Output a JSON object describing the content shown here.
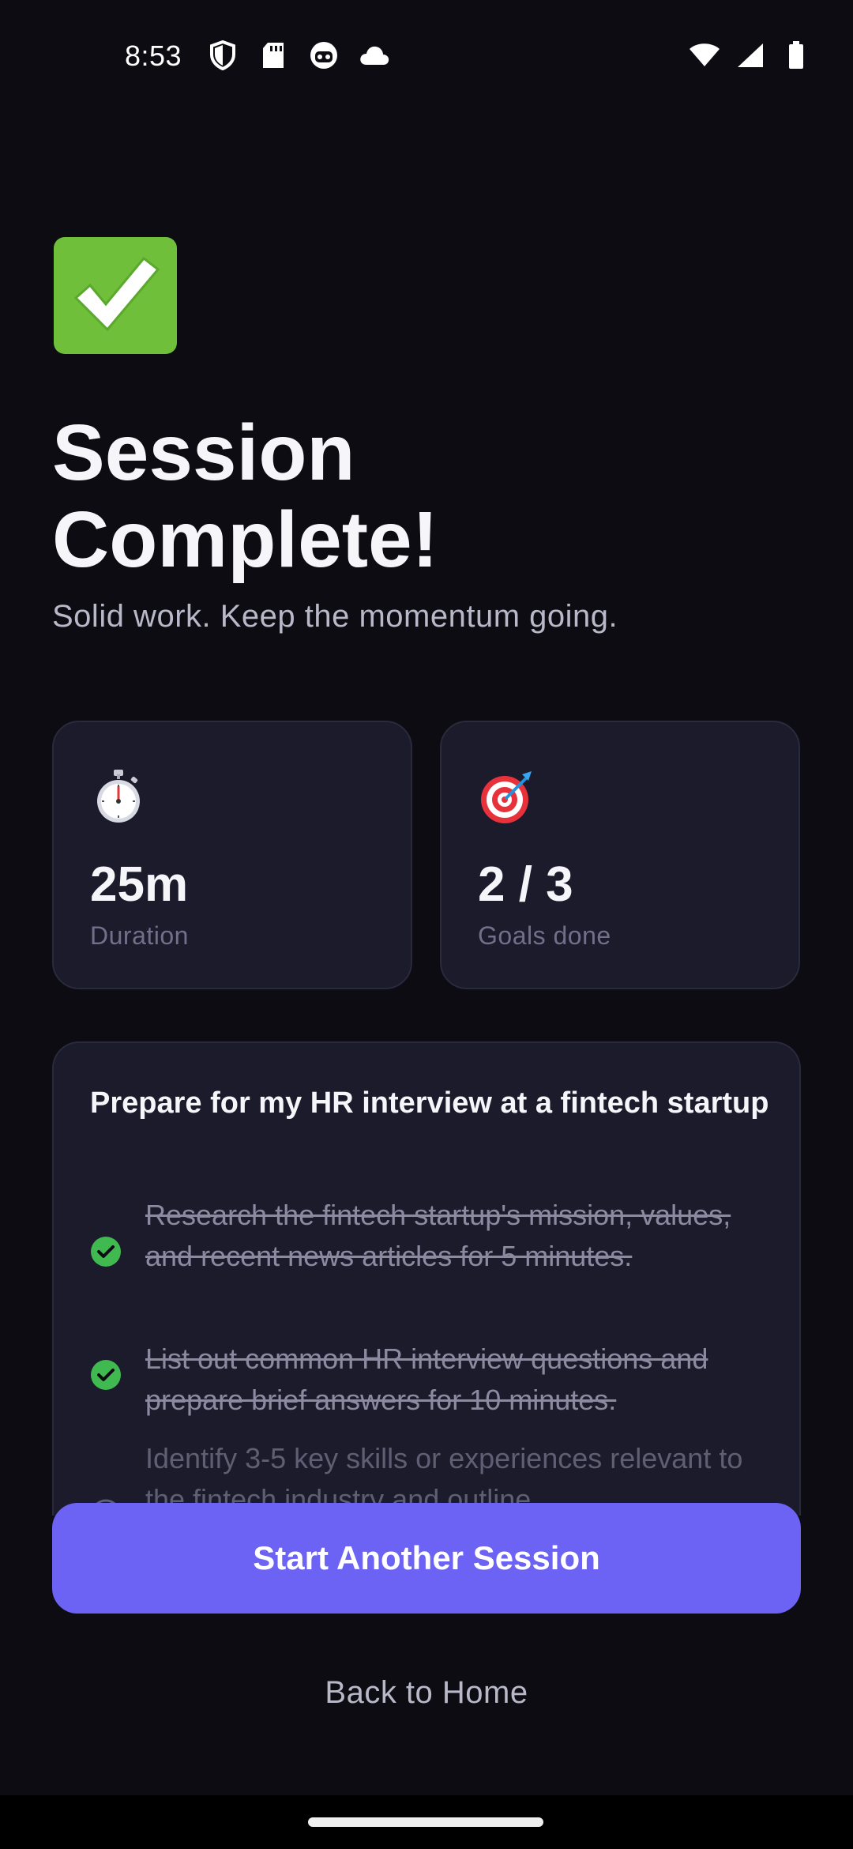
{
  "status_bar": {
    "time": "8:53"
  },
  "hero": {
    "icon": "check-mark-button-emoji",
    "title_line1": "Session",
    "title_line2": "Complete!",
    "subtitle": "Solid work. Keep the momentum going."
  },
  "stats": [
    {
      "icon": "stopwatch-icon",
      "value": "25m",
      "label": "Duration"
    },
    {
      "icon": "target-icon",
      "value": "2 / 3",
      "label": "Goals done"
    }
  ],
  "goal": {
    "title": "Prepare for my HR interview at a fintech startup",
    "tasks": [
      {
        "text": "Research the fintech startup's mission, values, and recent news articles for 5 minutes.",
        "done": true
      },
      {
        "text": "List out common HR interview questions and prepare brief answers for 10 minutes.",
        "done": true
      },
      {
        "text": "Identify 3-5 key skills or experiences relevant to the fintech industry and outline",
        "done": false
      }
    ]
  },
  "actions": {
    "primary_label": "Start Another Session",
    "secondary_label": "Back to Home"
  },
  "colors": {
    "background": "#0c0c12",
    "card": "#1b1b2c",
    "accent": "#6c63f5",
    "check": "#3fb950"
  }
}
